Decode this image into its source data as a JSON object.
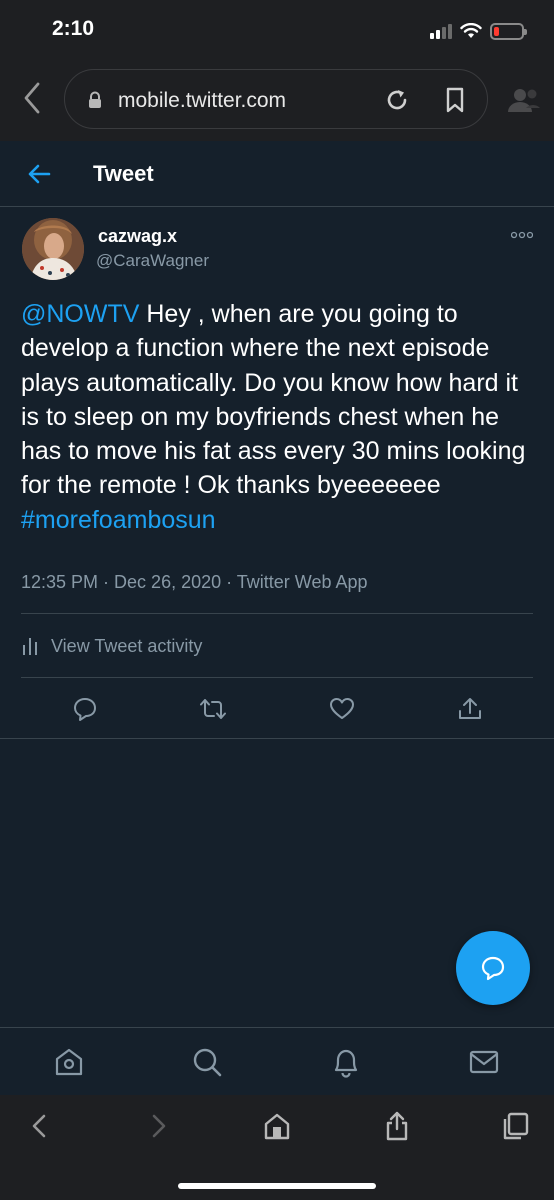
{
  "status_bar": {
    "time": "2:10"
  },
  "browser": {
    "url": "mobile.twitter.com"
  },
  "header": {
    "title": "Tweet"
  },
  "tweet": {
    "display_name": "cazwag.x",
    "handle": "@CaraWagner",
    "mention": "@NOWTV",
    "body": " Hey , when are you going to develop a function where the next episode plays automatically. Do you know how hard it is to sleep on my boyfriends chest when he has to move his fat ass every 30 mins looking for the remote ! Ok thanks byeeeeeee ",
    "hashtag": "#morefoambosun",
    "timestamp": "12:35 PM · Dec 26, 2020 · Twitter Web App",
    "activity_label": "View Tweet activity"
  },
  "icons": {
    "back": "chevron-left-icon",
    "lock": "lock-icon",
    "reload": "reload-icon",
    "bookmark": "bookmark-icon",
    "more": "more-icon",
    "reply": "reply-icon",
    "retweet": "retweet-icon",
    "like": "heart-icon",
    "share": "share-icon",
    "compose": "compose-icon",
    "home": "home-icon",
    "search": "search-icon",
    "notifications": "bell-icon",
    "messages": "mail-icon",
    "tabs": "tabs-icon"
  },
  "colors": {
    "background": "#15202b",
    "accent": "#1da1f2",
    "secondary_text": "#8899a6",
    "divider": "#38444d",
    "chrome": "#1e1f22"
  }
}
